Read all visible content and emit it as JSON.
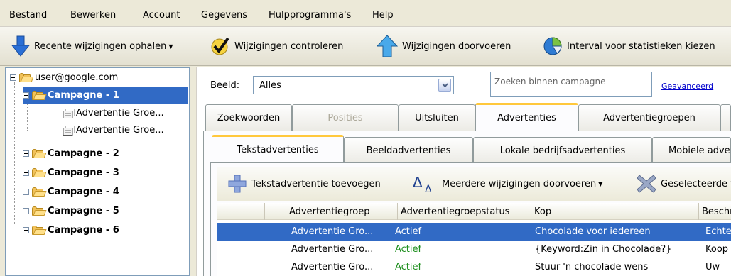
{
  "menu": {
    "items": [
      "Bestand",
      "Bewerken",
      "Account",
      "Gegevens",
      "Hulpprogramma's",
      "Help"
    ]
  },
  "toolbar": {
    "get_recent": "Recente wijzigingen ophalen",
    "check": "Wijzigingen controleren",
    "post": "Wijzigingen doorvoeren",
    "stats": "Interval voor statistieken kiezen"
  },
  "tree": {
    "account": "user@google.com",
    "selected_campaign": "Campagne - 1",
    "adgroups": [
      "Advertentie Groe...",
      "Advertentie Groe..."
    ],
    "campaigns": [
      "Campagne - 2",
      "Campagne - 3",
      "Campagne - 4",
      "Campagne - 5",
      "Campagne - 6"
    ]
  },
  "filter": {
    "view_label": "Beeld:",
    "view_value": "Alles",
    "search_placeholder": "Zoeken binnen campagne",
    "advanced_link": "Geavanceerd"
  },
  "main_tabs": [
    "Zoekwoorden",
    "Posities",
    "Uitsluiten",
    "Advertenties",
    "Advertentiegroepen"
  ],
  "main_tab_active": "Advertenties",
  "sub_tabs": [
    "Tekstadvertenties",
    "Beeldadvertenties",
    "Lokale bedrijfsadvertenties",
    "Mobiele advertenties"
  ],
  "sub_tab_active": "Tekstadvertenties",
  "actions": {
    "add": "Tekstadvertentie toevoegen",
    "multi": "Meerdere wijzigingen doorvoeren",
    "delete": "Geselecteerde verwijderen"
  },
  "table": {
    "columns": [
      "Advertentiegroep",
      "Advertentiegroepstatus",
      "Kop",
      "Beschrijving"
    ],
    "rows": [
      {
        "adgroup": "Advertentie Gro...",
        "status": "Actief",
        "headline": "Chocolade voor iedereen",
        "desc": "Echte"
      },
      {
        "adgroup": "Advertentie Gro...",
        "status": "Actief",
        "headline": "{Keyword:Zin in Chocolade?}",
        "desc": "Koop"
      },
      {
        "adgroup": "Advertentie Gro...",
        "status": "Actief",
        "headline": "Stuur 'n chocolade wens",
        "desc": "Uw"
      }
    ]
  },
  "colors": {
    "selection": "#316ac5",
    "active_tab_accent": "#ffc83c",
    "status_active": "#1e8f1e"
  }
}
